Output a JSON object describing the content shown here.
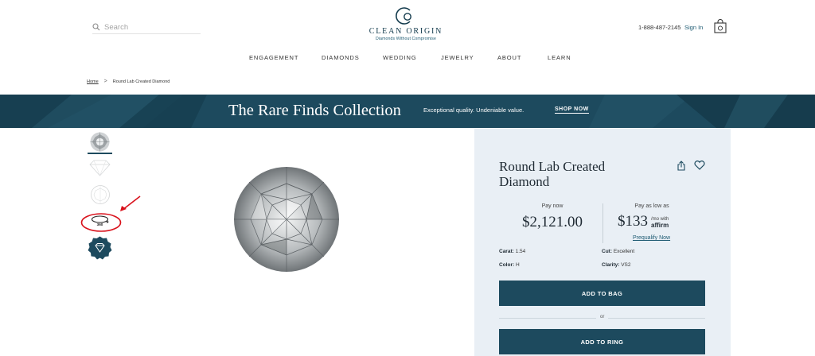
{
  "header": {
    "search_placeholder": "Search",
    "brand": "CLEAN ORIGIN",
    "tagline": "Diamonds Without Compromise",
    "phone": "1-888-487-2145",
    "sign_in": "Sign In",
    "search_icon": "search-icon",
    "bag_icon": "shopping-bag-icon"
  },
  "nav": {
    "items": [
      "ENGAGEMENT",
      "DIAMONDS",
      "WEDDING",
      "JEWELRY",
      "ABOUT",
      "LEARN"
    ]
  },
  "breadcrumb": {
    "home": "Home",
    "separator": ">",
    "current": "Round Lab Created Diamond"
  },
  "banner": {
    "title": "The Rare Finds Collection",
    "subtitle": "Exceptional quality. Undeniable value.",
    "cta": "SHOP NOW"
  },
  "gallery": {
    "thumb_360_label": "360",
    "thumbs": [
      "diamond-top-thumb",
      "diamond-side-thumb",
      "diamond-sketch-thumb",
      "360-view-thumb",
      "diamond-badge-thumb"
    ]
  },
  "product": {
    "title": "Round Lab Created Diamond",
    "pay_now_label": "Pay now",
    "price": "$2,121.00",
    "pay_low_label": "Pay as low as",
    "monthly": "$133",
    "per_month": "/mo with",
    "affirm": "affirm",
    "prequalify": "Prequalify Now",
    "specs": {
      "carat_label": "Carat:",
      "carat": "1.54",
      "cut_label": "Cut:",
      "cut": "Excellent",
      "color_label": "Color:",
      "color": "H",
      "clarity_label": "Clarity:",
      "clarity": "VS2"
    },
    "add_to_bag": "ADD TO BAG",
    "or": "or",
    "add_to_ring": "ADD TO RING"
  },
  "colors": {
    "brand_teal": "#1d4a5e",
    "panel_bg": "#e9eff5",
    "annotation_red": "#d9111b"
  }
}
